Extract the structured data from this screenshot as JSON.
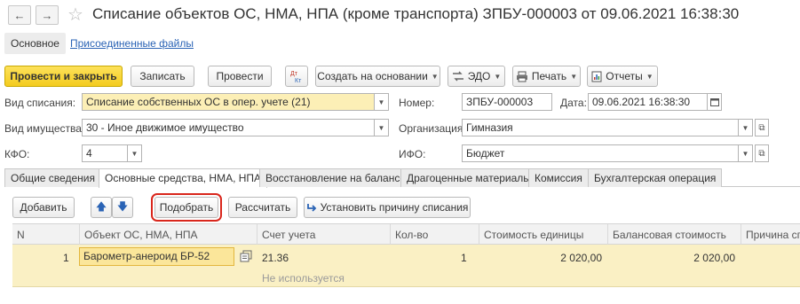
{
  "title": {
    "back_glyph": "←",
    "forward_glyph": "→",
    "star_glyph": "☆",
    "text": "Списание объектов ОС, НМА, НПА (кроме транспорта) ЗПБУ-000003 от 09.06.2021 16:38:30"
  },
  "nav": {
    "main_label": "Основное",
    "files_label": "Присоединенные файлы"
  },
  "toolbar": {
    "post_close": "Провести и закрыть",
    "save": "Записать",
    "post": "Провести",
    "dt_kt_icon": "Дт/Кт",
    "create_based": "Создать на основании",
    "edo": "ЭДО",
    "print": "Печать",
    "reports": "Отчеты"
  },
  "form": {
    "vid_spisaniya_label": "Вид списания:",
    "vid_spisaniya_value": "Списание собственных ОС в опер. учете (21)",
    "nomer_label": "Номер:",
    "nomer_value": "ЗПБУ-000003",
    "data_label": "Дата:",
    "data_value": "09.06.2021 16:38:30",
    "vid_imushchestva_label": "Вид имущества:",
    "vid_imushchestva_value": "30 - Иное движимое имущество",
    "organizaciya_label": "Организация:",
    "organizaciya_value": "Гимназия",
    "kfo_label": "КФО:",
    "kfo_value": "4",
    "ifo_label": "ИФО:",
    "ifo_value": "Бюджет"
  },
  "tabs": [
    {
      "label": "Общие сведения"
    },
    {
      "label": "Основные средства, НМА, НПА"
    },
    {
      "label": "Восстановление на балансе"
    },
    {
      "label": "Драгоценные материалы"
    },
    {
      "label": "Комиссия"
    },
    {
      "label": "Бухгалтерская операция"
    }
  ],
  "table_toolbar": {
    "add": "Добавить",
    "up_glyph": "🡅",
    "down_glyph": "🡇",
    "pick": "Подобрать",
    "calculate": "Рассчитать",
    "set_reason": "Установить причину списания"
  },
  "table": {
    "columns": [
      "N",
      "Объект ОС, НМА, НПА",
      "Счет учета",
      "Кол-во",
      "Стоимость единицы",
      "Балансовая стоимость",
      "Причина сп"
    ],
    "rows": [
      {
        "n": "1",
        "object": "Барометр-анероид БР-52",
        "account": "21.36",
        "account_sub": "Не используется",
        "qty": "1",
        "unit_cost": "2 020,00",
        "balance_cost": "2 020,00",
        "reason": ""
      }
    ]
  },
  "colors": {
    "accent_yellow": "#f4cc1f",
    "selected_row": "#faf0c4",
    "highlight_frame": "#d9261c",
    "link_blue": "#2a63b5"
  }
}
